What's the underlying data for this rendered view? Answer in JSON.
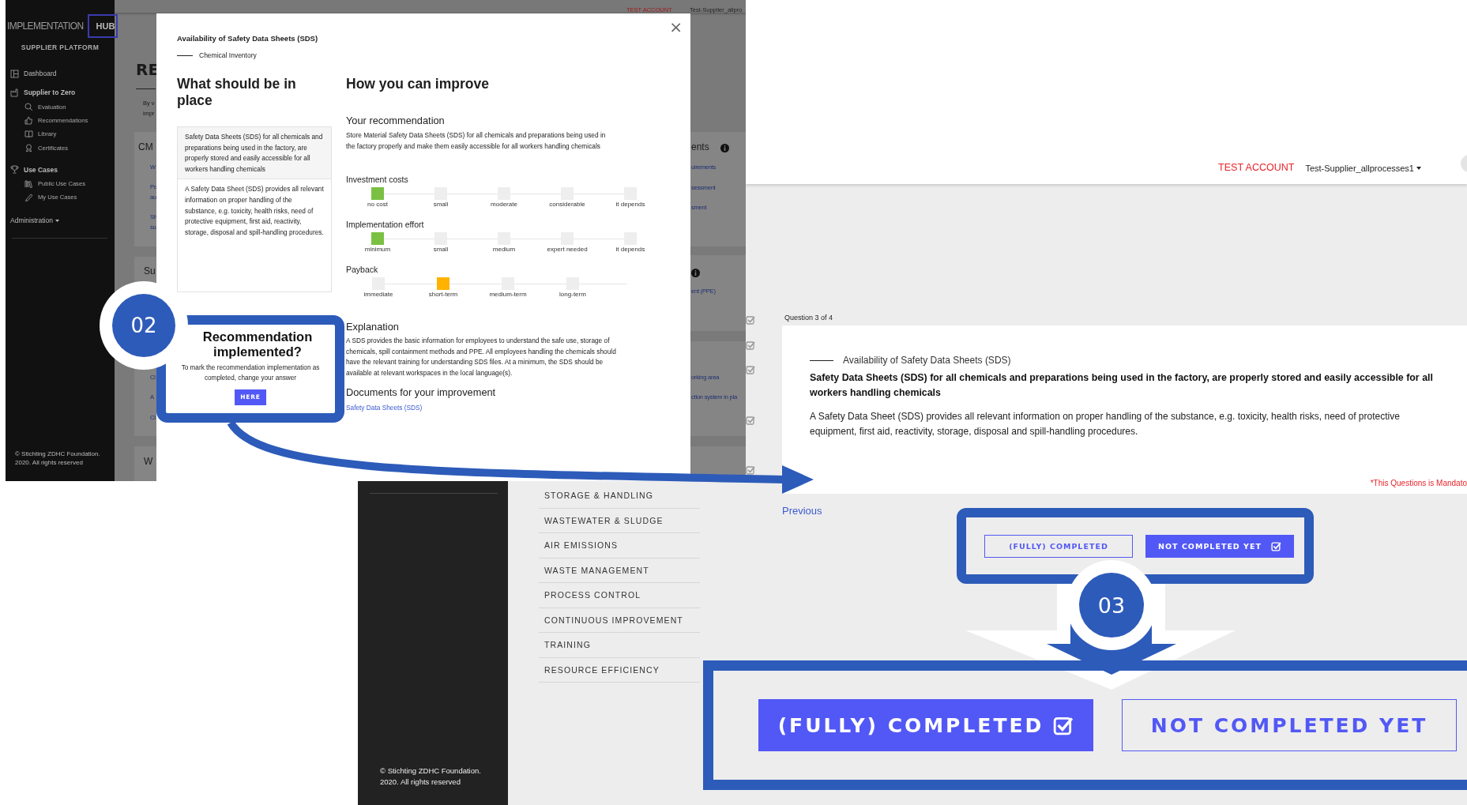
{
  "left_screen": {
    "sidebar": {
      "logo_left": "IMPLEMENTATION",
      "logo_right": "HUB",
      "subtitle": "SUPPLIER PLATFORM",
      "items": [
        {
          "label": "Dashboard"
        },
        {
          "label": "Supplier to Zero",
          "children": [
            {
              "label": "Evaluation"
            },
            {
              "label": "Recommendations"
            },
            {
              "label": "Library"
            },
            {
              "label": "Certificates"
            }
          ]
        },
        {
          "label": "Use Cases",
          "children": [
            {
              "label": "Public Use Cases"
            },
            {
              "label": "My Use Cases"
            }
          ]
        },
        {
          "label": "Administration",
          "menu": true
        }
      ],
      "footer_lines": [
        "© Stichting ZDHC Foundation.",
        "2020. All rights reserved"
      ]
    },
    "top_bar": {
      "account_label": "TEST ACCOUNT",
      "account_name": "Test-Supplier_allpro"
    },
    "left_fragments": [
      {
        "text": "RE",
        "kind": "heading"
      },
      {
        "text": "By v",
        "kind": "text"
      },
      {
        "text": "impr",
        "kind": "text"
      },
      {
        "text": "CM",
        "kind": "card-title"
      },
      {
        "text": "W",
        "kind": "link"
      },
      {
        "text": "Po",
        "kind": "link"
      },
      {
        "text": "au",
        "kind": "link"
      },
      {
        "text": "Sh",
        "kind": "link"
      },
      {
        "text": "su",
        "kind": "link"
      },
      {
        "text": "Su",
        "kind": "card-title"
      },
      {
        "text": "Cl",
        "kind": "link"
      },
      {
        "text": "A",
        "kind": "link"
      },
      {
        "text": "Cl",
        "kind": "link"
      },
      {
        "text": "W",
        "kind": "card-title"
      }
    ],
    "right_fragments": [
      {
        "text": "ents",
        "kind": "card-title"
      },
      {
        "text": "uirements",
        "kind": "link"
      },
      {
        "text": "sessment",
        "kind": "link"
      },
      {
        "text": "sment",
        "kind": "link"
      },
      {
        "kind": "info"
      },
      {
        "text": "ent (PPE)",
        "kind": "link"
      },
      {
        "text": "orking area",
        "kind": "link"
      },
      {
        "text": "ction system in pla",
        "kind": "link"
      }
    ],
    "modal": {
      "title": "Availability of Safety Data Sheets (SDS)",
      "category": "Chemical Inventory",
      "close": "×",
      "left_heading": "What should be in place",
      "requirement": "Safety Data Sheets (SDS) for all chemicals and preparations being used in the factory, are properly stored and easily accessible for all workers handling chemicals",
      "description": "A Safety Data Sheet (SDS) provides all relevant information on proper handling of the substance, e.g. toxicity, health risks, need of protective equipment, first aid, reactivity, storage, disposal and spill-handling procedures.",
      "right_heading": "How you can improve",
      "recommendation_heading": "Your recommendation",
      "recommendation": "Store Material Safety Data Sheets (SDS) for all chemicals and preparations being used in the factory properly and make them easily accessible for all workers handling chemicals",
      "scales": [
        {
          "label": "Investment costs",
          "color": "#7ac143",
          "options": [
            {
              "label": "no cost",
              "selected": true
            },
            {
              "label": "small",
              "selected": false
            },
            {
              "label": "moderate",
              "selected": false
            },
            {
              "label": "considerable",
              "selected": false
            },
            {
              "label": "it depends",
              "selected": false
            }
          ]
        },
        {
          "label": "Implementation effort",
          "color": "#7ac143",
          "options": [
            {
              "label": "minimum",
              "selected": true
            },
            {
              "label": "small",
              "selected": false
            },
            {
              "label": "medium",
              "selected": false
            },
            {
              "label": "expert needed",
              "selected": false
            },
            {
              "label": "it depends",
              "selected": false
            }
          ]
        },
        {
          "label": "Payback",
          "color": "#ffb300",
          "options": [
            {
              "label": "immediate",
              "selected": false
            },
            {
              "label": "short-term",
              "selected": true
            },
            {
              "label": "medium-term",
              "selected": false
            },
            {
              "label": "long-term",
              "selected": false
            }
          ]
        }
      ],
      "explanation_heading": "Explanation",
      "explanation": "A SDS provides the basic information for employees to understand the safe use, storage of chemicals, spill containment methods and PPE. All employees handling the chemicals should have the relevant training for understanding SDS files. At a minimum, the SDS should be available at relevant workspaces in the local language(s).",
      "documents_heading": "Documents for your improvement",
      "documents": [
        "Safety Data Sheets (SDS)"
      ]
    }
  },
  "callout_02": {
    "number": "02",
    "title": "Recommendation implemented?",
    "text": "To mark the recommendation implementation as completed, change your answer",
    "button": "HERE"
  },
  "right_screen": {
    "account_label": "TEST ACCOUNT",
    "account_name": "Test-Supplier_allprocesses1",
    "side_checks": [
      {
        "checked": true
      },
      {
        "checked": true
      },
      {
        "checked": true
      },
      {
        "checked": true
      },
      {
        "checked": true
      }
    ],
    "categories": [
      "STORAGE & HANDLING",
      "WASTEWATER & SLUDGE",
      "AIR EMISSIONS",
      "WASTE MANAGEMENT",
      "PROCESS CONTROL",
      "CONTINUOUS IMPROVEMENT",
      "TRAINING",
      "RESOURCE EFFICIENCY"
    ],
    "footer_lines": [
      "© Stichting ZDHC Foundation.",
      "2020. All rights reserved"
    ],
    "question": {
      "counter": "Question 3 of 4",
      "category": "Availability of Safety Data Sheets (SDS)",
      "statement": "Safety Data Sheets (SDS) for all chemicals and preparations being used in the factory, are properly stored and easily accessible for all workers handling chemicals",
      "description": "A Safety Data Sheet (SDS) provides all relevant information on proper handling of the substance, e.g. toxicity, health risks, need of protective equipment, first aid, reactivity, storage, disposal and spill-handling procedures.",
      "mandatory": "*This Questions is Mandato"
    },
    "previous": "Previous",
    "answers": [
      {
        "label": "(FULLY) COMPLETED",
        "selected": false
      },
      {
        "label": "NOT COMPLETED YET",
        "selected": true
      }
    ]
  },
  "callout_03": {
    "number": "03",
    "answers": [
      {
        "label": "(FULLY) COMPLETED",
        "selected": true
      },
      {
        "label": "NOT COMPLETED YET",
        "selected": false
      }
    ]
  }
}
